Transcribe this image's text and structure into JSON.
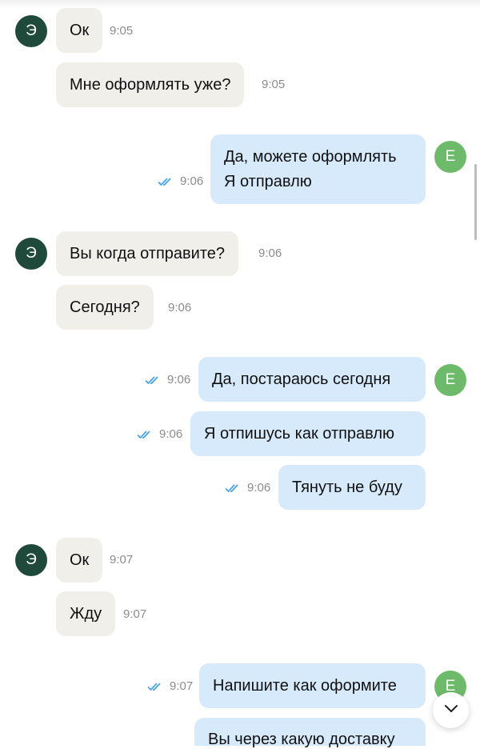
{
  "avatars": {
    "contact": "Э",
    "me": "Е"
  },
  "messages": [
    {
      "text": "Ок",
      "time": "9:05"
    },
    {
      "text": "Мне оформлять уже?",
      "time": "9:05"
    },
    {
      "lines": [
        "Да, можете оформлять",
        "Я отправлю"
      ],
      "time": "9:06"
    },
    {
      "text": "Вы когда отправите?",
      "time": "9:06"
    },
    {
      "text": "Сегодня?",
      "time": "9:06"
    },
    {
      "text": "Да, постараюсь сегодня",
      "time": "9:06"
    },
    {
      "text": "Я отпишусь как отправлю",
      "time": "9:06"
    },
    {
      "text": "Тянуть не буду",
      "time": "9:06"
    },
    {
      "text": "Ок",
      "time": "9:07"
    },
    {
      "text": "Жду",
      "time": "9:07"
    },
    {
      "text": "Напишите как оформите",
      "time": "9:07"
    },
    {
      "text": "Вы через какую доставку"
    }
  ],
  "icons": {
    "read_receipt": "double-check-icon",
    "scroll_down": "chevron-down-icon"
  },
  "colors": {
    "incoming_bubble": "#f1efea",
    "outgoing_bubble": "#d6eafc",
    "contact_avatar": "#1f4a3b",
    "my_avatar": "#6dbb6a",
    "read_check": "#4aa3e8"
  }
}
